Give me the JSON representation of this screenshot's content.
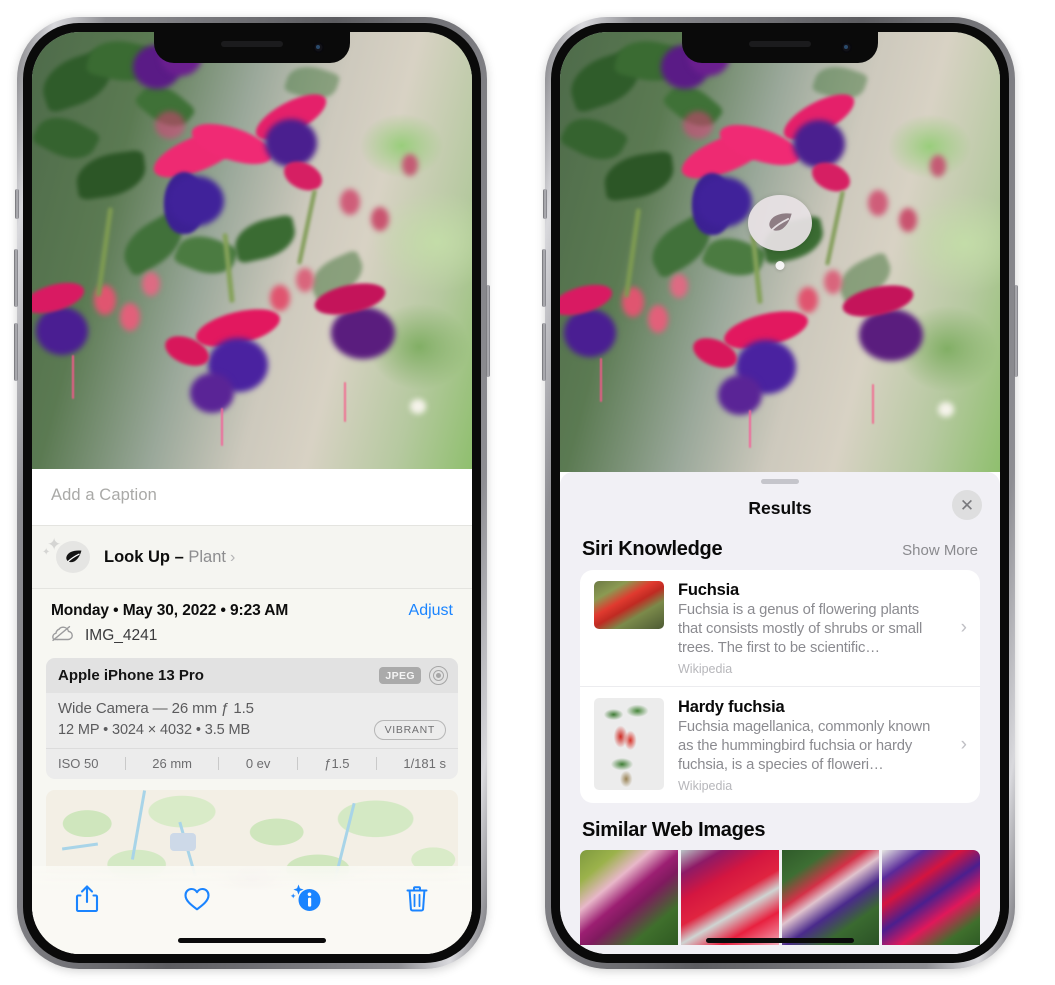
{
  "left_phone": {
    "photo": {
      "alt": "fuchsia-flowers-photo"
    },
    "caption": {
      "placeholder": "Add a Caption",
      "value": ""
    },
    "look_up": {
      "icon": "leaf-icon",
      "label": "Look Up –",
      "subject": "Plant",
      "chevron": "›"
    },
    "datetime": "Monday • May 30, 2022 • 9:23 AM",
    "adjust_label": "Adjust",
    "filename": "IMG_4241",
    "cloud_icon": "icloud-slash-icon",
    "metadata": {
      "device": "Apple iPhone 13 Pro",
      "format_badge": "JPEG",
      "hdr_icon": "hdr-aperture-icon",
      "lens": "Wide Camera — 26 mm ƒ 1.5",
      "size_line": "12 MP • 3024 × 4032 • 3.5 MB",
      "style_badge": "VIBRANT",
      "exif": [
        "ISO 50",
        "26 mm",
        "0 ev",
        "ƒ1.5",
        "1/181 s"
      ]
    },
    "map": {
      "pin_label": "photo-location-pin"
    },
    "toolbar": [
      {
        "name": "share-icon",
        "label": "Share"
      },
      {
        "name": "heart-icon",
        "label": "Favorite"
      },
      {
        "name": "info-sparkle-icon",
        "label": "Info"
      },
      {
        "name": "trash-icon",
        "label": "Delete"
      }
    ]
  },
  "right_phone": {
    "photo_badge": {
      "icon": "leaf-icon",
      "name": "visual-look-up-badge"
    },
    "sheet": {
      "title": "Results",
      "close_label": "✕",
      "sections": [
        {
          "title": "Siri Knowledge",
          "action": "Show More",
          "items": [
            {
              "title": "Fuchsia",
              "description": "Fuchsia is a genus of flowering plants that consists mostly of shrubs or small trees. The first to be scientific…",
              "source": "Wikipedia",
              "chevron": "›"
            },
            {
              "title": "Hardy fuchsia",
              "description": "Fuchsia magellanica, commonly known as the hummingbird fuchsia or hardy fuchsia, is a species of floweri…",
              "source": "Wikipedia",
              "chevron": "›"
            }
          ]
        },
        {
          "title": "Similar Web Images",
          "thumbnails": [
            "similar-web-image-1",
            "similar-web-image-2",
            "similar-web-image-3",
            "similar-web-image-4"
          ]
        }
      ]
    }
  },
  "colors": {
    "accent_blue": "#1a84ff",
    "sheet_bg": "#f1f0f5",
    "info_bg": "#f7f7f2",
    "card_bg": "#ffffff",
    "secondary_text": "#8b8b90"
  }
}
